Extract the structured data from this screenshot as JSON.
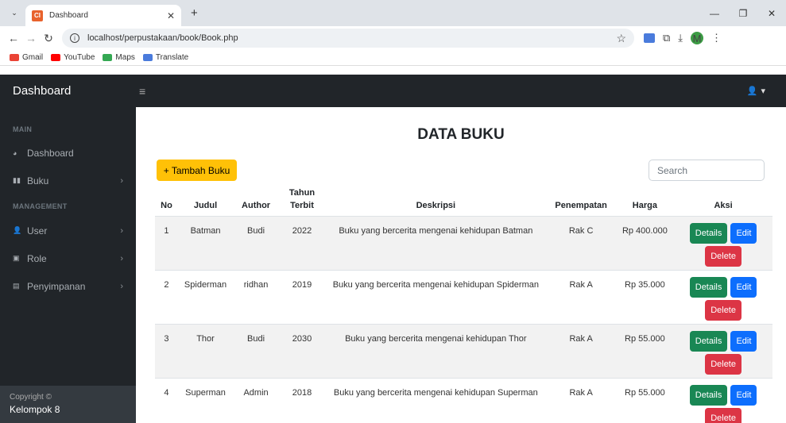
{
  "browser": {
    "tab_title": "Dashboard",
    "url": "localhost/perpustakaan/book/Book.php",
    "bookmarks": [
      "Gmail",
      "YouTube",
      "Maps",
      "Translate"
    ],
    "profile_initial": "M"
  },
  "app": {
    "brand": "Dashboard",
    "sidebar": {
      "heading_main": "MAIN",
      "heading_management": "MANAGEMENT",
      "items": [
        {
          "label": "Dashboard"
        },
        {
          "label": "Buku"
        },
        {
          "label": "User"
        },
        {
          "label": "Role"
        },
        {
          "label": "Penyimpanan"
        }
      ],
      "footer_small": "Copyright ©",
      "footer_name": "Kelompok 8"
    },
    "main": {
      "title": "DATA BUKU",
      "add_button": "+ Tambah Buku",
      "search_placeholder": "Search",
      "columns": [
        "No",
        "Judul",
        "Author",
        "Tahun Terbit",
        "Deskripsi",
        "Penempatan",
        "Harga",
        "Aksi"
      ],
      "rows": [
        {
          "no": "1",
          "judul": "Batman",
          "author": "Budi",
          "tahun": "2022",
          "deskripsi": "Buku yang bercerita mengenai kehidupan Batman",
          "penempatan": "Rak C",
          "harga": "Rp 400.000"
        },
        {
          "no": "2",
          "judul": "Spiderman",
          "author": "ridhan",
          "tahun": "2019",
          "deskripsi": "Buku yang bercerita mengenai kehidupan Spiderman",
          "penempatan": "Rak A",
          "harga": "Rp 35.000"
        },
        {
          "no": "3",
          "judul": "Thor",
          "author": "Budi",
          "tahun": "2030",
          "deskripsi": "Buku yang bercerita mengenai kehidupan Thor",
          "penempatan": "Rak A",
          "harga": "Rp 55.000"
        },
        {
          "no": "4",
          "judul": "Superman",
          "author": "Admin",
          "tahun": "2018",
          "deskripsi": "Buku yang bercerita mengenai kehidupan Superman",
          "penempatan": "Rak A",
          "harga": "Rp 55.000"
        }
      ],
      "actions": {
        "details": "Details",
        "edit": "Edit",
        "delete": "Delete"
      }
    }
  },
  "colors": {
    "navbar": "#212529",
    "add_button": "#ffc107",
    "details": "#198754",
    "edit": "#0d6efd",
    "delete": "#dc3545"
  }
}
